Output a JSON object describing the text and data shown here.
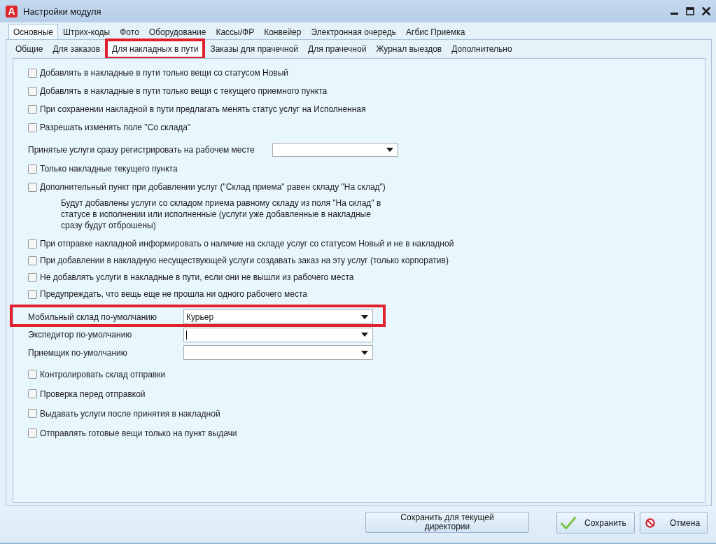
{
  "window": {
    "logo": "A",
    "title": "Настройки модуля"
  },
  "tabs": [
    {
      "label": "Основные",
      "selected": true
    },
    {
      "label": "Штрих-коды",
      "selected": false
    },
    {
      "label": "Фото",
      "selected": false
    },
    {
      "label": "Оборудование",
      "selected": false
    },
    {
      "label": "Кассы/ФР",
      "selected": false
    },
    {
      "label": "Конвейер",
      "selected": false
    },
    {
      "label": "Электронная очередь",
      "selected": false
    },
    {
      "label": "Агбис Приемка",
      "selected": false
    }
  ],
  "subtabs": [
    {
      "label": "Общие",
      "selected": false,
      "highlighted": false
    },
    {
      "label": "Для заказов",
      "selected": false,
      "highlighted": false
    },
    {
      "label": "Для накладных в пути",
      "selected": true,
      "highlighted": true
    },
    {
      "label": "Заказы для прачечной",
      "selected": false,
      "highlighted": false
    },
    {
      "label": "Для прачечной",
      "selected": false,
      "highlighted": false
    },
    {
      "label": "Журнал выездов",
      "selected": false,
      "highlighted": false
    },
    {
      "label": "Дополнительно",
      "selected": false,
      "highlighted": false
    }
  ],
  "settings": [
    {
      "kind": "checkbox",
      "label": "Добавлять в накладные в пути только вещи со статусом Новый",
      "checked": false
    },
    {
      "kind": "checkbox",
      "label": "Добавлять в накладные в пути только вещи с текущего приемного пункта",
      "checked": false
    },
    {
      "kind": "checkbox",
      "label": "При сохранении накладной в пути предлагать менять статус услуг на Исполненная",
      "checked": false
    },
    {
      "kind": "checkbox",
      "label": "Разрешать изменять поле \"Со склада\"",
      "checked": false
    },
    {
      "kind": "combo",
      "label": "Принятые услуги сразу регистрировать на рабочем месте"
    },
    {
      "kind": "checkbox",
      "label": "Только накладные текущего пункта",
      "checked": false
    },
    {
      "kind": "checkbox",
      "label": "Дополнительный пункт при добавлении услуг (\"Склад приема\" равен складу \"На склад\")",
      "checked": false
    },
    {
      "kind": "note",
      "text": "Будут добавлены услуги со складом приема равному складу из поля \"На склад\" в статусе в исполнении или исполненные (услуги уже добавленные в накладные сразу будут отброшены)"
    },
    {
      "kind": "checkbox",
      "label": "При отправке накладной информировать о наличие на складе услуг со статусом Новый и не в накладной",
      "checked": false
    },
    {
      "kind": "checkbox",
      "label": "При добавлении в накладную несуществующей услуги создавать заказ на эту услуг (только корпоратив)",
      "checked": false
    },
    {
      "kind": "checkbox",
      "label": "Не добавлять услуги в накладные в пути, если они не вышли из рабочего места",
      "checked": false
    },
    {
      "kind": "checkbox",
      "label": "Предупреждать, что вещь еще не прошла ни одного рабочего места",
      "checked": false
    }
  ],
  "default_fields": [
    {
      "label": "Мобильный склад по-умолчанию",
      "value": "Курьер",
      "highlighted": true,
      "focused": false
    },
    {
      "label": "Экспедитор по-умолчанию",
      "highlighted": false,
      "focused": true
    },
    {
      "label": "Приемщик по-умолчанию",
      "highlighted": false,
      "focused": false
    }
  ],
  "settings_bottom": [
    {
      "kind": "checkbox",
      "label": "Контролировать склад отправки",
      "checked": false
    },
    {
      "kind": "checkbox",
      "label": "Проверка перед отправкой",
      "checked": false
    },
    {
      "kind": "checkbox",
      "label": "Выдавать услуги после принятия в накладной",
      "checked": false
    },
    {
      "kind": "checkbox",
      "label": "Отправлять готовые вещи только на пункт выдачи",
      "checked": false
    }
  ],
  "buttons": [
    {
      "kind": "plain",
      "label": "Сохранить для текущей директории"
    },
    {
      "kind": "ok",
      "label": "Сохранить"
    },
    {
      "kind": "cancel",
      "label": "Отмена"
    }
  ]
}
